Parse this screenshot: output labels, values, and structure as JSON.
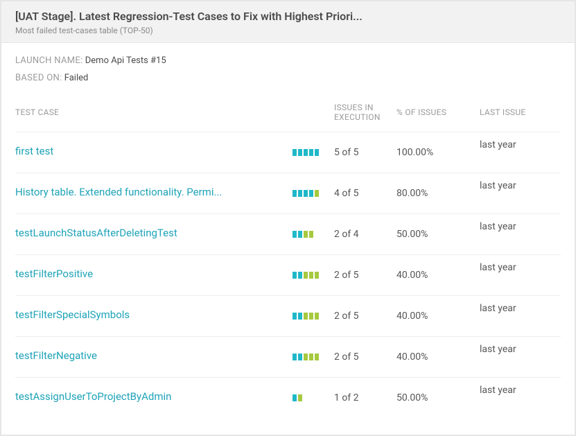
{
  "header": {
    "title": "[UAT Stage]. Latest Regression-Test Cases to Fix with Highest Priori...",
    "subtitle": "Most failed test-cases table (TOP-50)"
  },
  "meta": {
    "launch_label": "LAUNCH NAME:",
    "launch_value": "Demo Api Tests #15",
    "based_label": "BASED ON:",
    "based_value": "Failed"
  },
  "columns": {
    "testcase": "TEST CASE",
    "issues": "ISSUES IN EXECUTION",
    "pct": "% OF ISSUES",
    "last": "LAST ISSUE"
  },
  "rows": [
    {
      "name": "first test",
      "fail": 5,
      "total": 5,
      "issues": "5 of 5",
      "pct": "100.00%",
      "last": "last year"
    },
    {
      "name": "History table. Extended functionality. Permi...",
      "fail": 4,
      "total": 5,
      "issues": "4 of 5",
      "pct": "80.00%",
      "last": "last year"
    },
    {
      "name": "testLaunchStatusAfterDeletingTest",
      "fail": 2,
      "total": 4,
      "issues": "2 of 4",
      "pct": "50.00%",
      "last": "last year"
    },
    {
      "name": "testFilterPositive",
      "fail": 2,
      "total": 5,
      "issues": "2 of 5",
      "pct": "40.00%",
      "last": "last year"
    },
    {
      "name": "testFilterSpecialSymbols",
      "fail": 2,
      "total": 5,
      "issues": "2 of 5",
      "pct": "40.00%",
      "last": "last year"
    },
    {
      "name": "testFilterNegative",
      "fail": 2,
      "total": 5,
      "issues": "2 of 5",
      "pct": "40.00%",
      "last": "last year"
    },
    {
      "name": "testAssignUserToProjectByAdmin",
      "fail": 1,
      "total": 2,
      "issues": "1 of 2",
      "pct": "50.00%",
      "last": "last year"
    }
  ]
}
